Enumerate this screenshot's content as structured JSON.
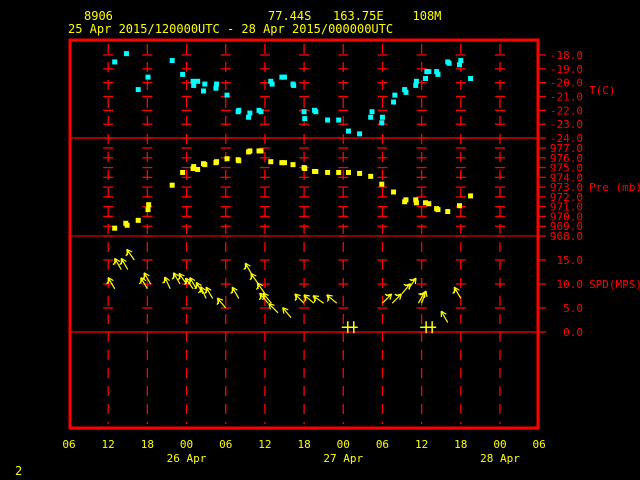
{
  "header": {
    "station_id": "8906",
    "location": "77.44S   163.75E    108M",
    "time_range": "25 Apr 2015/120000UTC - 28 Apr 2015/000000UTC"
  },
  "page_number": "2",
  "colors": {
    "frame": "#ff0000",
    "temperature": "#00ffff",
    "pressure": "#ffff00",
    "wind": "#ffff00",
    "background": "#000000"
  },
  "chart_data": {
    "type": "scatter",
    "title": "8906  77.44S 163.75E 108M",
    "x_units": "hours since 25 Apr 2015 06 UTC",
    "xlim": [
      0,
      72
    ],
    "x_tick_labels": [
      "06",
      "12",
      "18",
      "00",
      "06",
      "12",
      "18",
      "00",
      "06",
      "12",
      "18",
      "00",
      "06"
    ],
    "date_labels": [
      {
        "hour": 18,
        "label": "26 Apr"
      },
      {
        "hour": 42,
        "label": "27 Apr"
      },
      {
        "hour": 66,
        "label": "28 Apr"
      }
    ],
    "grid": true,
    "panels": [
      {
        "name": "temperature",
        "ylabel": "T(C)",
        "ylim": [
          -24,
          -18
        ],
        "tick_labels": [
          "-18.0",
          "-19.0",
          "-20.0",
          "-21.0",
          "-22.0",
          "-23.0",
          "-24.0"
        ],
        "points": [
          [
            7.0,
            -18.5
          ],
          [
            8.8,
            -17.9
          ],
          [
            10.6,
            -20.5
          ],
          [
            12.1,
            -19.6
          ],
          [
            15.8,
            -18.4
          ],
          [
            17.4,
            -19.4
          ],
          [
            19.0,
            -19.9
          ],
          [
            19.1,
            -20.2
          ],
          [
            19.7,
            -19.9
          ],
          [
            20.6,
            -20.6
          ],
          [
            20.8,
            -20.1
          ],
          [
            22.5,
            -20.4
          ],
          [
            22.6,
            -20.1
          ],
          [
            24.2,
            -20.9
          ],
          [
            25.9,
            -22.1
          ],
          [
            26.0,
            -22.0
          ],
          [
            27.5,
            -22.5
          ],
          [
            27.7,
            -22.2
          ],
          [
            29.1,
            -22.0
          ],
          [
            29.4,
            -22.1
          ],
          [
            30.9,
            -19.9
          ],
          [
            31.1,
            -20.1
          ],
          [
            32.6,
            -19.6
          ],
          [
            33.0,
            -19.6
          ],
          [
            34.3,
            -20.1
          ],
          [
            34.4,
            -20.2
          ],
          [
            36.0,
            -22.1
          ],
          [
            36.1,
            -22.6
          ],
          [
            37.6,
            -22.0
          ],
          [
            37.8,
            -22.1
          ],
          [
            39.6,
            -22.7
          ],
          [
            41.3,
            -22.7
          ],
          [
            42.8,
            -23.5
          ],
          [
            44.5,
            -23.7
          ],
          [
            46.2,
            -22.5
          ],
          [
            46.4,
            -22.1
          ],
          [
            47.9,
            -22.9
          ],
          [
            48.0,
            -22.5
          ],
          [
            49.7,
            -21.4
          ],
          [
            49.9,
            -20.9
          ],
          [
            51.4,
            -20.5
          ],
          [
            51.6,
            -20.7
          ],
          [
            53.1,
            -20.2
          ],
          [
            53.2,
            -19.9
          ],
          [
            54.6,
            -19.7
          ],
          [
            54.8,
            -19.2
          ],
          [
            55.1,
            -19.2
          ],
          [
            56.3,
            -19.2
          ],
          [
            56.5,
            -19.4
          ],
          [
            58.0,
            -18.5
          ],
          [
            58.2,
            -18.6
          ],
          [
            59.8,
            -18.7
          ],
          [
            60.0,
            -18.4
          ],
          [
            61.5,
            -19.7
          ]
        ]
      },
      {
        "name": "pressure",
        "ylabel": "Pre (mb)",
        "ylim": [
          968,
          977
        ],
        "tick_labels": [
          "977.0",
          "976.0",
          "975.0",
          "974.0",
          "973.0",
          "972.0",
          "971.0",
          "970.0",
          "969.0",
          "968.0"
        ],
        "points": [
          [
            7.0,
            968.8
          ],
          [
            8.7,
            969.3
          ],
          [
            8.9,
            969.1
          ],
          [
            10.6,
            969.6
          ],
          [
            12.1,
            970.7
          ],
          [
            12.2,
            971.2
          ],
          [
            15.8,
            973.2
          ],
          [
            17.4,
            974.5
          ],
          [
            19.0,
            974.9
          ],
          [
            19.1,
            975.1
          ],
          [
            19.7,
            974.8
          ],
          [
            20.6,
            975.4
          ],
          [
            20.8,
            975.3
          ],
          [
            22.5,
            975.5
          ],
          [
            22.6,
            975.6
          ],
          [
            24.2,
            975.9
          ],
          [
            25.9,
            975.8
          ],
          [
            26.0,
            975.7
          ],
          [
            27.5,
            976.6
          ],
          [
            27.7,
            976.7
          ],
          [
            29.1,
            976.7
          ],
          [
            29.4,
            976.7
          ],
          [
            30.9,
            975.6
          ],
          [
            32.6,
            975.5
          ],
          [
            33.0,
            975.5
          ],
          [
            34.3,
            975.3
          ],
          [
            36.0,
            975.0
          ],
          [
            36.1,
            974.9
          ],
          [
            37.6,
            974.6
          ],
          [
            37.8,
            974.6
          ],
          [
            39.6,
            974.5
          ],
          [
            41.3,
            974.5
          ],
          [
            42.8,
            974.5
          ],
          [
            44.5,
            974.4
          ],
          [
            46.2,
            974.1
          ],
          [
            47.9,
            973.3
          ],
          [
            49.7,
            972.5
          ],
          [
            51.4,
            971.5
          ],
          [
            51.6,
            971.7
          ],
          [
            53.1,
            971.7
          ],
          [
            53.2,
            971.4
          ],
          [
            54.6,
            971.4
          ],
          [
            55.1,
            971.3
          ],
          [
            56.3,
            970.8
          ],
          [
            56.5,
            970.7
          ],
          [
            58.0,
            970.5
          ],
          [
            59.8,
            971.1
          ],
          [
            61.5,
            972.1
          ]
        ]
      },
      {
        "name": "wind_speed",
        "ylabel": "SPD(MPS)",
        "ylim": [
          0,
          15
        ],
        "tick_labels": [
          "15.0",
          "10.0",
          "5.0",
          "0.0"
        ],
        "points_hour_speed_dir": [
          [
            7,
            9,
            150
          ],
          [
            8,
            13,
            150
          ],
          [
            9,
            13,
            150
          ],
          [
            10,
            15,
            145
          ],
          [
            12,
            9,
            150
          ],
          [
            12.5,
            10,
            150
          ],
          [
            15.5,
            9,
            155
          ],
          [
            17,
            10,
            150
          ],
          [
            18,
            10,
            145
          ],
          [
            19,
            9,
            145
          ],
          [
            19.5,
            9,
            150
          ],
          [
            20.5,
            8,
            150
          ],
          [
            21,
            7,
            155
          ],
          [
            22,
            7,
            150
          ],
          [
            24,
            5,
            140
          ],
          [
            26,
            7,
            150
          ],
          [
            28,
            12,
            150
          ],
          [
            29,
            10,
            145
          ],
          [
            30,
            8,
            145
          ],
          [
            30.5,
            6,
            140
          ],
          [
            31,
            6,
            140
          ],
          [
            32,
            4,
            135
          ],
          [
            34,
            3,
            140
          ],
          [
            36,
            6,
            135
          ],
          [
            37.5,
            6,
            130
          ],
          [
            39,
            6,
            125
          ],
          [
            41,
            6,
            130
          ],
          [
            43,
            1,
            200
          ],
          [
            48,
            6,
            225
          ],
          [
            49.5,
            6,
            225
          ],
          [
            51,
            8,
            220
          ],
          [
            52,
            9,
            215
          ],
          [
            53.5,
            6,
            210
          ],
          [
            54,
            6,
            200
          ],
          [
            55,
            1,
            350
          ],
          [
            58,
            2,
            150
          ],
          [
            60,
            7,
            150
          ]
        ]
      }
    ]
  }
}
